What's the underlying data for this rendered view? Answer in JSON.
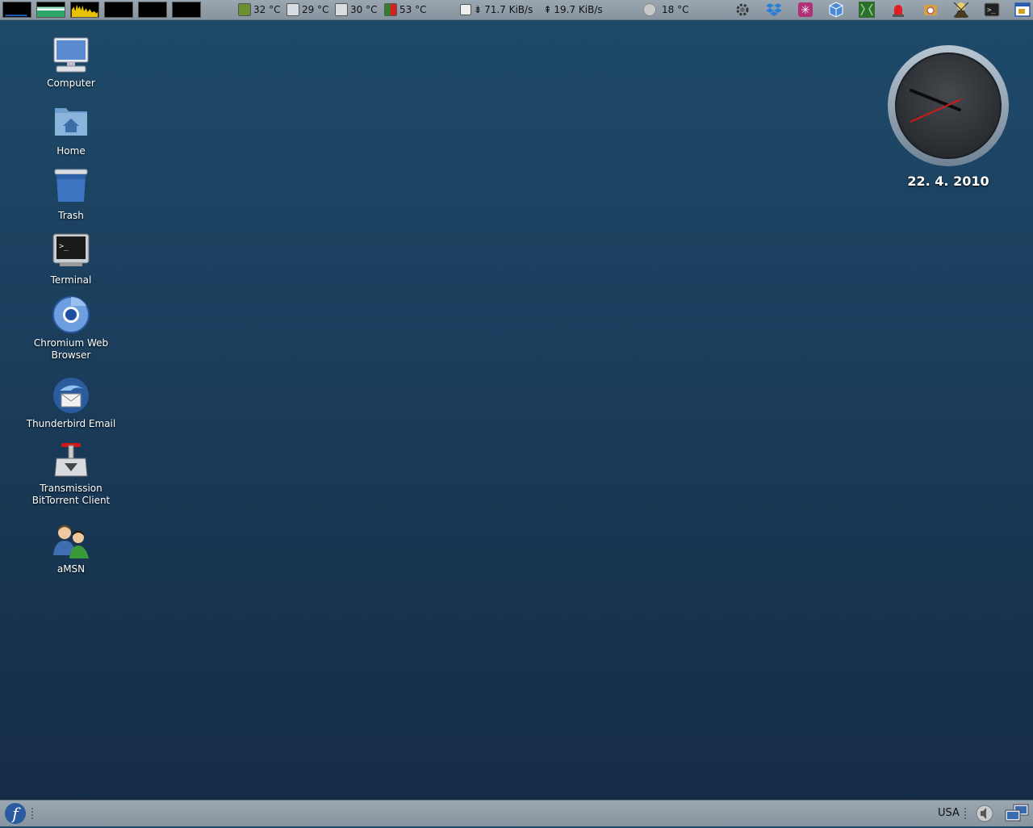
{
  "colors": {
    "desktop_top": "#1f4a6a",
    "desktop_bottom": "#152b45",
    "panel": "#8e9ba6"
  },
  "top_panel": {
    "system_monitors": [
      "cpu-monitor-icon",
      "memory-monitor-icon",
      "network-monitor-icon",
      "swap-monitor-icon",
      "load-monitor-icon",
      "disk-monitor-icon"
    ],
    "sensors": [
      {
        "icon": "cpu-chip-icon",
        "value": "32 °C"
      },
      {
        "icon": "drive-icon",
        "value": "29 °C"
      },
      {
        "icon": "drive-icon",
        "value": "30 °C"
      },
      {
        "icon": "gpu-icon",
        "value": "53 °C"
      }
    ],
    "network": {
      "download": "71.7 KiB/s",
      "upload": "19.7 KiB/s"
    },
    "weather": "18 °C",
    "tray_icons": [
      "gear-icon",
      "dropbox-icon",
      "settings-icon",
      "virtualbox-icon",
      "package-icon",
      "alert-icon",
      "update-icon",
      "hitman-icon",
      "terminal-icon",
      "window-icon"
    ]
  },
  "desktop": {
    "icons": [
      {
        "label": "Computer",
        "icon": "computer-icon"
      },
      {
        "label": "Home",
        "icon": "home-folder-icon"
      },
      {
        "label": "Trash",
        "icon": "trash-icon"
      },
      {
        "label": "Terminal",
        "icon": "terminal-icon"
      },
      {
        "label": "Chromium Web Browser",
        "icon": "chromium-icon"
      },
      {
        "label": "Thunderbird Email",
        "icon": "thunderbird-icon"
      },
      {
        "label": "Transmission BitTorrent Client",
        "icon": "transmission-icon"
      },
      {
        "label": "aMSN",
        "icon": "amsn-icon"
      }
    ]
  },
  "clock": {
    "date": "22. 4. 2010"
  },
  "bottom_panel": {
    "keyboard_layout": "USA",
    "start_icon": "fedora-logo-icon",
    "volume_icon": "volume-icon",
    "network_icon": "network-computer-icon"
  }
}
